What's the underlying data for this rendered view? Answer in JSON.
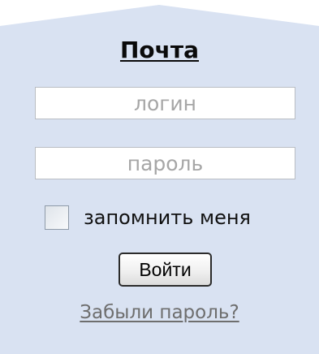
{
  "panel": {
    "background_color": "#d9e2f2",
    "title": "Почта"
  },
  "login_field": {
    "placeholder": "логин",
    "value": ""
  },
  "password_field": {
    "placeholder": "пароль",
    "value": ""
  },
  "remember_me": {
    "label": "запомнить меня",
    "checked": false
  },
  "submit_button": {
    "label": "Войти"
  },
  "forgot_link": {
    "label": "Забыли пароль?"
  }
}
